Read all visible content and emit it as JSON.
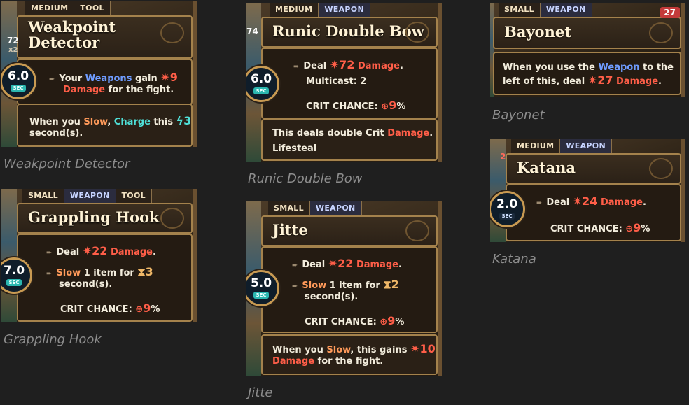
{
  "captions": {
    "weakpoint": "Weakpoint Detector",
    "runic": "Runic Double Bow",
    "bayonet": "Bayonet",
    "grappling": "Grappling Hook",
    "jitte": "Jitte",
    "katana": "Katana"
  },
  "weakpoint": {
    "tags": [
      "MEDIUM",
      "TOOL"
    ],
    "title_line1": "Weakpoint",
    "title_line2": "Detector",
    "timer": "6.0",
    "timer_unit": "SEC",
    "side_num": "72",
    "side_mult": "x2",
    "ability": {
      "p1": "Your ",
      "weapons": "Weapons",
      "p2": " gain ",
      "value": "9",
      "damage": "Damage",
      "p3": " for the fight."
    },
    "footer": {
      "p1": "When you ",
      "slow": "Slow",
      "p2": ", ",
      "charge": "Charge",
      "p3": " this ",
      "value": "3",
      "p4": "second(s)."
    }
  },
  "runic": {
    "tags": [
      "MEDIUM",
      "WEAPON"
    ],
    "title": "Runic Double Bow",
    "timer": "6.0",
    "timer_unit": "SEC",
    "side_num": "74",
    "deal": "Deal ",
    "damage_value": "72",
    "damage": "Damage",
    "multicast": "Multicast: 2",
    "crit_label": "CRIT CHANCE:",
    "crit_value": "9",
    "crit_unit": "%",
    "footer": {
      "p1": "This deals double Crit ",
      "damage": "Damage",
      "p2": ".",
      "lifesteal": "Lifesteal"
    }
  },
  "bayonet": {
    "tags": [
      "SMALL",
      "WEAPON"
    ],
    "title": "Bayonet",
    "side_num": "27",
    "ability": {
      "p1": "When you use the ",
      "weapon": "Weapon",
      "p2": " to the",
      "p3": "left of this, deal ",
      "value": "27",
      "damage": "Damage",
      "p4": "."
    }
  },
  "grappling": {
    "tags": [
      "SMALL",
      "WEAPON",
      "TOOL"
    ],
    "title": "Grappling Hook",
    "timer": "7.0",
    "timer_unit": "SEC",
    "deal": "Deal ",
    "damage_value": "22",
    "damage": "Damage",
    "slow": "Slow",
    "slow_text": " 1 item for ",
    "slow_value": "3",
    "seconds": "second(s).",
    "crit_label": "CRIT CHANCE:",
    "crit_value": "9",
    "crit_unit": "%"
  },
  "jitte": {
    "tags": [
      "SMALL",
      "WEAPON"
    ],
    "title": "Jitte",
    "timer": "5.0",
    "timer_unit": "SEC",
    "deal": "Deal ",
    "damage_value": "22",
    "damage": "Damage",
    "slow": "Slow",
    "slow_text": " 1 item for ",
    "slow_value": "2",
    "seconds": "second(s).",
    "crit_label": "CRIT CHANCE:",
    "crit_value": "9",
    "crit_unit": "%",
    "footer": {
      "p1": "When you ",
      "slow": "Slow",
      "p2": ", this gains ",
      "value": "10",
      "damage": "Damage",
      "p3": " for the fight."
    }
  },
  "katana": {
    "tags": [
      "MEDIUM",
      "WEAPON"
    ],
    "title": "Katana",
    "timer": "2.0",
    "timer_unit": "SEC",
    "side_num": "2",
    "deal": "Deal ",
    "damage_value": "24",
    "damage": "Damage",
    "crit_label": "CRIT CHANCE:",
    "crit_value": "9",
    "crit_unit": "%"
  },
  "colors": {
    "background": "#1f1f1f",
    "gold_border": "#a4824c",
    "damage_red": "#ff5e48",
    "weapon_blue": "#6f9cff",
    "charge_teal": "#4fe0d8",
    "timer_teal": "#2bb7b0"
  },
  "icons": [
    "damage-burst-icon",
    "lightning-icon",
    "crit-target-icon",
    "slow-hourglass-icon",
    "arrow-bullet-icon",
    "item-emblem-icon"
  ]
}
